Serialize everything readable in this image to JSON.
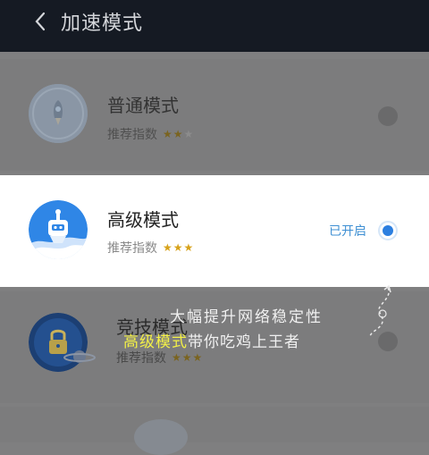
{
  "header": {
    "title": "加速模式"
  },
  "modes": [
    {
      "name": "普通模式",
      "rating_label": "推荐指数",
      "stars_filled": 2,
      "stars_total": 3,
      "selected": false,
      "status": ""
    },
    {
      "name": "高级模式",
      "rating_label": "推荐指数",
      "stars_filled": 3,
      "stars_total": 3,
      "selected": true,
      "status": "已开启"
    },
    {
      "name": "竞技模式",
      "rating_label": "推荐指数",
      "stars_filled": 3,
      "stars_total": 3,
      "selected": false,
      "status": ""
    }
  ],
  "overlay": {
    "line1": "大幅提升网络稳定性",
    "line2_highlight": "高级模式",
    "line2_rest": "带你吃鸡上王者"
  },
  "colors": {
    "header_bg": "#151a23",
    "accent_blue": "#2c7fe0",
    "star_gold": "#d7a21a",
    "highlight_yellow": "#f3f047"
  },
  "icons": {
    "back": "chevron-left-icon",
    "mode1": "rocket-icon",
    "mode2": "robot-rocket-icon",
    "mode3": "lock-planet-icon",
    "decor": "curl-doodle-icon"
  }
}
